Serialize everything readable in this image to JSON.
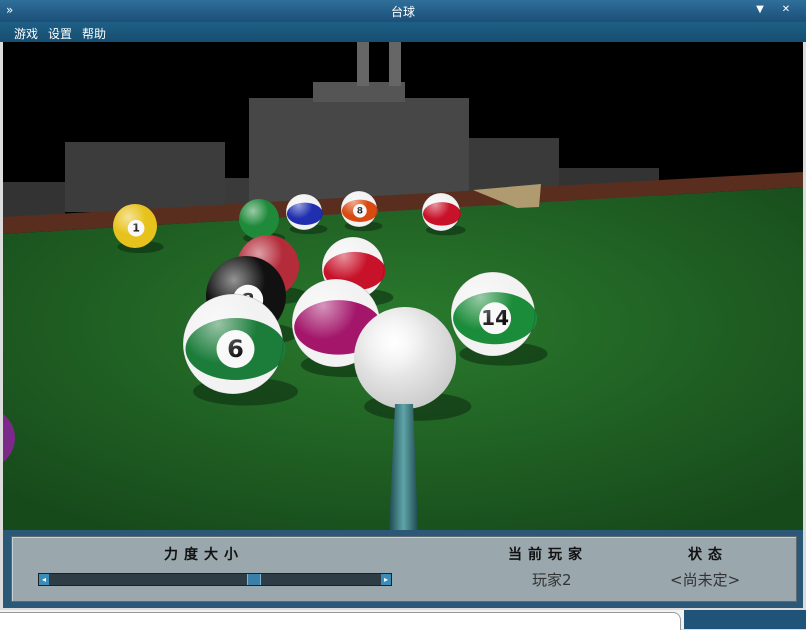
{
  "window": {
    "title": "台球"
  },
  "menu": [
    "游戏",
    "设置",
    "帮助"
  ],
  "panel": {
    "power_label": "力度大小",
    "player_label": "当前玩家",
    "player_value": "玩家2",
    "status_label": "状态",
    "status_value": "<尚未定>",
    "power_level": 0.62
  },
  "balls": [
    {
      "number": "1",
      "kind": "solid",
      "color": "#e8c21c"
    },
    {
      "number": "",
      "kind": "solid",
      "color": "#1f8a3a"
    },
    {
      "number": "",
      "kind": "stripe",
      "color": "#1f2fb0"
    },
    {
      "number": "8",
      "kind": "stripe",
      "color": "#d84a10"
    },
    {
      "number": "",
      "kind": "stripe",
      "color": "#c8122a"
    },
    {
      "number": "",
      "kind": "solid",
      "color": "#b42b3a"
    },
    {
      "number": "",
      "kind": "stripe",
      "color": "#c8122a"
    },
    {
      "number": "8",
      "kind": "solid",
      "color": "#111111"
    },
    {
      "number": "14",
      "kind": "stripe",
      "color": "#1b8c3a"
    },
    {
      "number": "",
      "kind": "stripe",
      "color": "#a3166a"
    },
    {
      "number": "6",
      "kind": "stripe",
      "color": "#1c7d3b"
    },
    {
      "number": "",
      "kind": "cue",
      "color": "#f4f4f4"
    }
  ],
  "colors": {
    "felt": "#1e5d23",
    "titlebar": "#1b4f78",
    "panel": "#9aa7ad"
  }
}
